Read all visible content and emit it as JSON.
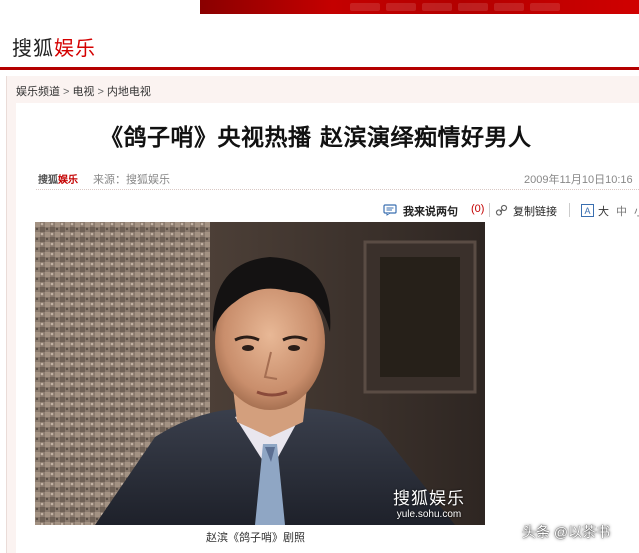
{
  "brand": {
    "sohu": "搜狐",
    "yule": "娱乐"
  },
  "breadcrumb": {
    "items": [
      "娱乐频道",
      "电视",
      "内地电视"
    ],
    "separator": ">"
  },
  "article": {
    "title": "《鸽子哨》央视热播 赵滨演绎痴情好男人",
    "mini_logo_sohu": "搜狐",
    "mini_logo_yule": "娱乐",
    "source": "来源：搜狐娱乐",
    "date": "2009年11月10日10:16"
  },
  "tools": {
    "comment_label": "我来说两句",
    "comment_count": "(0)",
    "copy_link": "复制链接",
    "font_sizes": [
      "大",
      "中",
      "小"
    ]
  },
  "photo": {
    "caption": "赵滨《鸽子哨》剧照",
    "watermark_brand": "搜狐娱乐",
    "watermark_url": "yule.sohu.com"
  },
  "overlay": {
    "watermark": "头条 @以茶书"
  },
  "colors": {
    "accent": "#c40000",
    "brand_red": "#d40000",
    "frame_bg": "#fbf3f1"
  }
}
